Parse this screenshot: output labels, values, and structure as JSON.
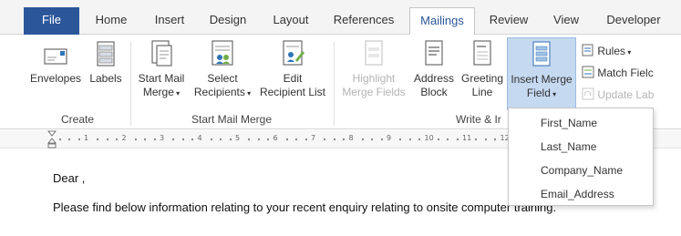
{
  "tabs": {
    "file": "File",
    "home": "Home",
    "insert": "Insert",
    "design": "Design",
    "layout": "Layout",
    "references": "References",
    "mailings": "Mailings",
    "review": "Review",
    "view": "View",
    "developer": "Developer"
  },
  "ribbon": {
    "create": {
      "envelopes": "Envelopes",
      "labels": "Labels",
      "group_label": "Create"
    },
    "start_mail_merge": {
      "start_line1": "Start Mail",
      "start_line2": "Merge",
      "select_line1": "Select",
      "select_line2": "Recipients",
      "edit_line1": "Edit",
      "edit_line2": "Recipient List",
      "group_label": "Start Mail Merge"
    },
    "write_insert": {
      "highlight_line1": "Highlight",
      "highlight_line2": "Merge Fields",
      "address_line1": "Address",
      "address_line2": "Block",
      "greeting_line1": "Greeting",
      "greeting_line2": "Line",
      "insert_line1": "Insert Merge",
      "insert_line2": "Field",
      "rules": "Rules",
      "match_fields": "Match Fielc",
      "update_labels": "Update Lab",
      "group_label": "Write & Ir"
    }
  },
  "ruler": {
    "numbers": [
      "1",
      "2",
      "3",
      "4",
      "5",
      "6",
      "7",
      "8",
      "9",
      "10",
      "11",
      "12"
    ]
  },
  "dropdown": {
    "items": [
      "First_Name",
      "Last_Name",
      "Company_Name",
      "Email_Address"
    ]
  },
  "document": {
    "line1": "Dear ,",
    "line2": "Please find below information relating to your recent enquiry relating to onsite computer training."
  },
  "colors": {
    "file_tab": "#2b579a",
    "selected_button": "#c5d9f1",
    "accent": "#2b579a"
  }
}
